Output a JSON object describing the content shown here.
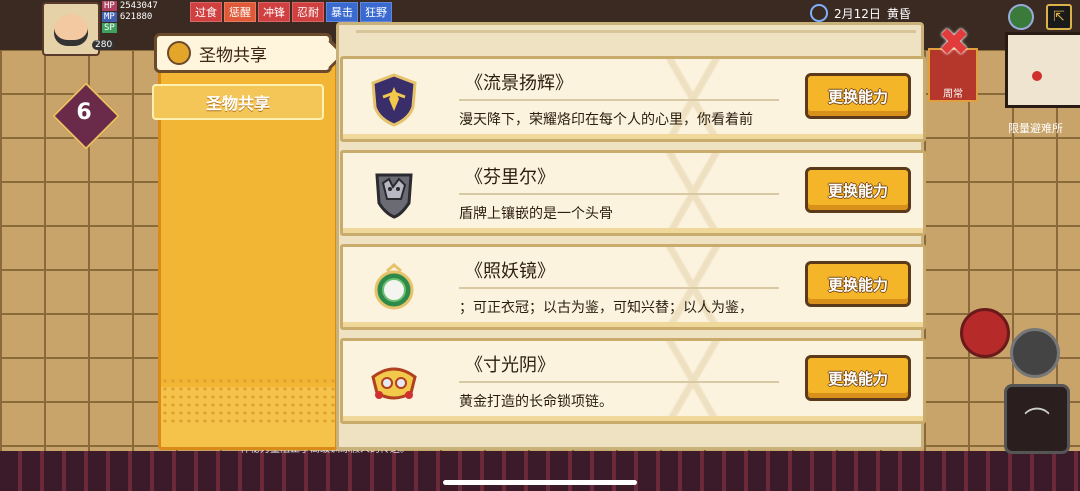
{
  "hud": {
    "hp_label": "HP",
    "hp_value": "2543047",
    "mp_label": "MP",
    "mp_value": "621880",
    "sp_label": "SP",
    "level": "280",
    "buffs": [
      "过食",
      "惩醒",
      "冲锋",
      "忍耐",
      "暴击",
      "狂野"
    ],
    "date": "2月12日",
    "time_of_day": "黄昏",
    "weekly_label": "周常",
    "shelter_label": "限量避难所",
    "floor_badge": "6",
    "chat_snippet": "神秘力量阻止了高级训练假人的传送。"
  },
  "tabs": {
    "header_label": "圣物共享",
    "items": [
      {
        "label": "圣物共享"
      }
    ]
  },
  "close_icon": "close-icon",
  "relics": [
    {
      "title": "《流景扬辉》",
      "desc": "漫天降下，荣耀烙印在每个人的心里，你看着前",
      "button": "更换能力",
      "icon": "shield-crest-icon"
    },
    {
      "title": "《芬里尔》",
      "desc": "盾牌上镶嵌的是一个头骨",
      "button": "更换能力",
      "icon": "wolf-skull-shield-icon"
    },
    {
      "title": "《照妖镜》",
      "desc": "；可正衣冠；以古为鉴，可知兴替；以人为鉴，",
      "button": "更换能力",
      "icon": "jade-mirror-icon"
    },
    {
      "title": "《寸光阴》",
      "desc": "黄金打造的长命锁项链。",
      "button": "更换能力",
      "icon": "golden-lock-icon"
    }
  ]
}
